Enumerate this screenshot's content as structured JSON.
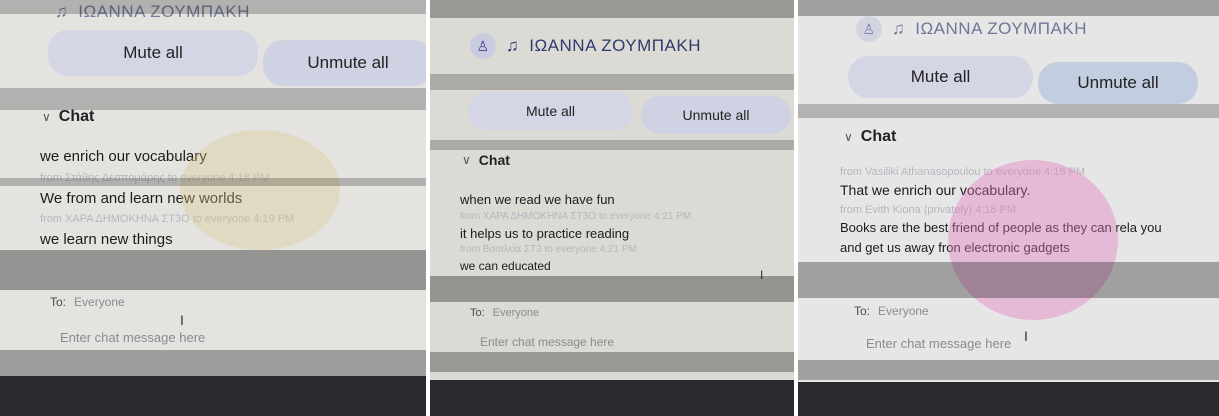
{
  "panel1": {
    "header_name": "ΙΩΑΝΝΑ ΖΟΥΜΠΑΚΗ",
    "mute_all": "Mute all",
    "unmute_all": "Unmute all",
    "chat_title": "Chat",
    "messages": [
      {
        "text": "we enrich our vocabulary"
      },
      {
        "meta": "from Στάθης Δεσπομάρης to everyone   4:18 PM"
      },
      {
        "text": "We from and learn new worlds"
      },
      {
        "meta": "from ΧΑΡΑ ΔΗΜΟΚΗΝΑ ΣΤ3Ο to everyone   4:19 PM"
      },
      {
        "text": "we learn new things"
      }
    ],
    "to_label": "To:",
    "to_value": "Everyone",
    "input_placeholder": "Enter chat message here"
  },
  "panel2": {
    "header_name": "ΙΩΑΝΝΑ ΖΟΥΜΠΑΚΗ",
    "mute_all": "Mute all",
    "unmute_all": "Unmute all",
    "chat_title": "Chat",
    "messages": [
      {
        "text": "when we read we have fun"
      },
      {
        "meta": "from ΧΑΡΑ ΔΗΜΟΚΗΝΑ ΣΤ3Ο to everyone   4:21 PM"
      },
      {
        "text": "it helps us to practice reading"
      },
      {
        "meta": "from Βασιλεία ΣΤ3 to everyone   4:21 PM"
      },
      {
        "text": "we can educated"
      }
    ],
    "to_label": "To:",
    "to_value": "Everyone",
    "input_placeholder": "Enter chat message here"
  },
  "panel3": {
    "header_name": "ΙΩΑΝΝΑ ΖΟΥΜΠΑΚΗ",
    "mute_all": "Mute all",
    "unmute_all": "Unmute all",
    "chat_title": "Chat",
    "messages": [
      {
        "meta": "from Vasiliki Athanasopoulou to everyone   4:16 PM"
      },
      {
        "text": "That we enrich our vocabulary."
      },
      {
        "meta": "from Evith Kiona (privately)   4:18 PM"
      },
      {
        "text": "Books are the best friend of people as they can rela you"
      },
      {
        "text": "and get us away fron electronic gadgets"
      }
    ],
    "to_label": "To:",
    "to_value": "Everyone",
    "input_placeholder": "Enter chat message here"
  },
  "icons": {
    "avatar": "person-icon",
    "audio": "audio-icon",
    "chevron": "chevron-down-icon"
  },
  "colors": {
    "button_fill": "#d4d6e6",
    "header_text": "#2d3b6e"
  }
}
